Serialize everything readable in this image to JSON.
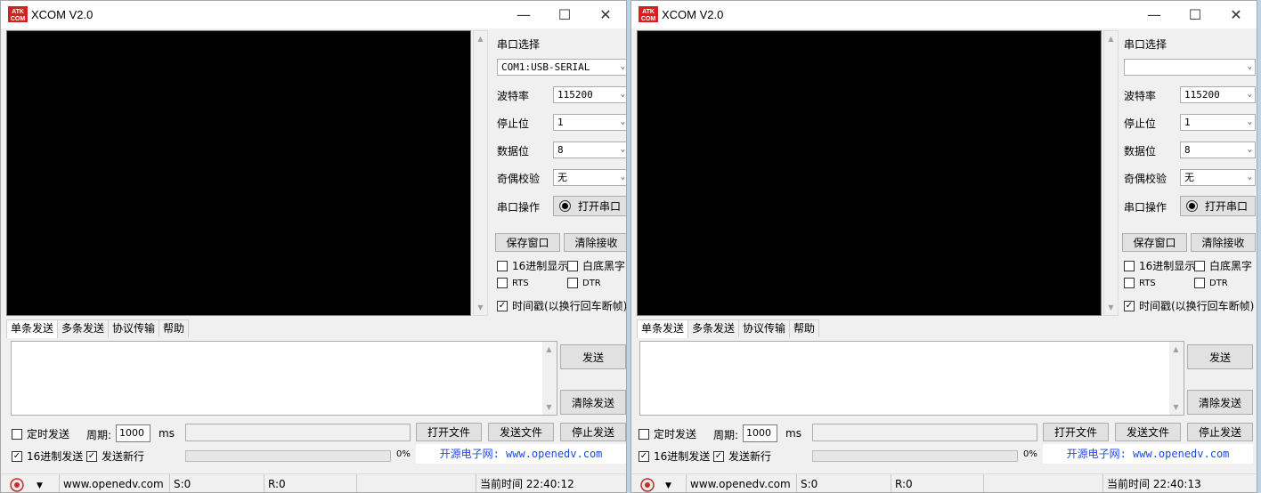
{
  "windows": [
    {
      "title": "XCOM V2.0",
      "logo_text": "ATK COM",
      "port_select_label": "串口选择",
      "port_value": "COM1:USB-SERIAL",
      "baud_label": "波特率",
      "baud_value": "115200",
      "stop_label": "停止位",
      "stop_value": "1",
      "data_label": "数据位",
      "data_value": "8",
      "parity_label": "奇偶校验",
      "parity_value": "无",
      "op_label": "串口操作",
      "open_label": "打开串口",
      "save_window": "保存窗口",
      "clear_recv": "清除接收",
      "hex_display": "16进制显示",
      "white_bg": "白底黑字",
      "rts": "RTS",
      "dtr": "DTR",
      "timestamp": "时间戳(以换行回车断帧)",
      "tabs": [
        "单条发送",
        "多条发送",
        "协议传输",
        "帮助"
      ],
      "send": "发送",
      "clear_send": "清除发送",
      "timed_send": "定时发送",
      "period_label": "周期:",
      "period_value": "1000",
      "ms": "ms",
      "open_file": "打开文件",
      "send_file": "发送文件",
      "stop_send": "停止发送",
      "hex_send": "16进制发送",
      "send_newline": "发送新行",
      "progress": "0%",
      "site_link": "开源电子网: www.openedv.com",
      "status": {
        "url": "www.openedv.com",
        "sent": "S:0",
        "recv": "R:0",
        "time": "当前时间 22:40:12"
      }
    },
    {
      "title": "XCOM V2.0",
      "logo_text": "ATK COM",
      "port_select_label": "串口选择",
      "port_value": "",
      "baud_label": "波特率",
      "baud_value": "115200",
      "stop_label": "停止位",
      "stop_value": "1",
      "data_label": "数据位",
      "data_value": "8",
      "parity_label": "奇偶校验",
      "parity_value": "无",
      "op_label": "串口操作",
      "open_label": "打开串口",
      "save_window": "保存窗口",
      "clear_recv": "清除接收",
      "hex_display": "16进制显示",
      "white_bg": "白底黑字",
      "rts": "RTS",
      "dtr": "DTR",
      "timestamp": "时间戳(以换行回车断帧)",
      "tabs": [
        "单条发送",
        "多条发送",
        "协议传输",
        "帮助"
      ],
      "send": "发送",
      "clear_send": "清除发送",
      "timed_send": "定时发送",
      "period_label": "周期:",
      "period_value": "1000",
      "ms": "ms",
      "open_file": "打开文件",
      "send_file": "发送文件",
      "stop_send": "停止发送",
      "hex_send": "16进制发送",
      "send_newline": "发送新行",
      "progress": "0%",
      "site_link": "开源电子网: www.openedv.com",
      "status": {
        "url": "www.openedv.com",
        "sent": "S:0",
        "recv": "R:0",
        "time": "当前时间 22:40:13"
      }
    }
  ],
  "colors": {
    "receive_bg": "#000000",
    "link": "#1e47ff",
    "logo": "#d42020"
  }
}
